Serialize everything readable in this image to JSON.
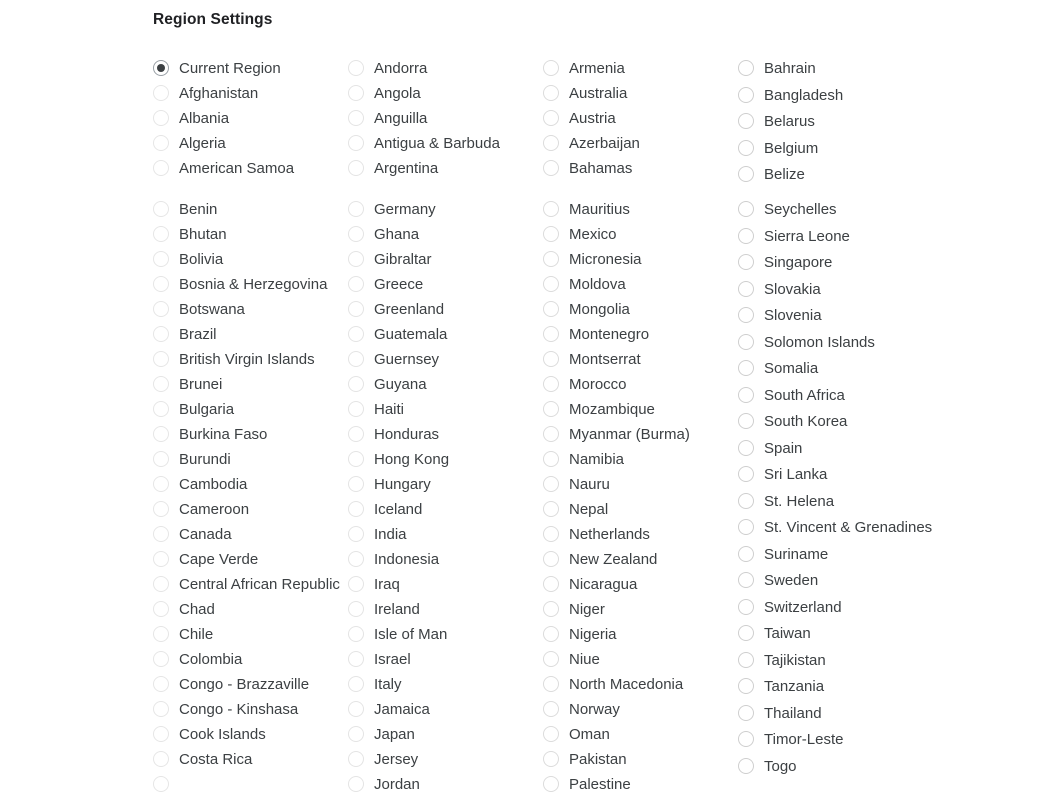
{
  "page": {
    "title": "Region Settings",
    "background_color": "#ffffff",
    "text_color": "#3c4043",
    "selected_dot_color": "#3c4043",
    "radio_ring_color": "#e2e2e2"
  },
  "selected_region": "Current Region",
  "groups": [
    {
      "name": "primary-region-group",
      "columns": [
        {
          "name": "column-a",
          "options": [
            {
              "label": "Current Region",
              "selected": true
            },
            {
              "label": "Afghanistan",
              "selected": false
            },
            {
              "label": "Albania",
              "selected": false
            },
            {
              "label": "Algeria",
              "selected": false
            },
            {
              "label": "American Samoa",
              "selected": false
            }
          ]
        },
        {
          "name": "column-b",
          "options": [
            {
              "label": "Andorra",
              "selected": false
            },
            {
              "label": "Angola",
              "selected": false
            },
            {
              "label": "Anguilla",
              "selected": false
            },
            {
              "label": "Antigua & Barbuda",
              "selected": false
            },
            {
              "label": "Argentina",
              "selected": false
            }
          ]
        },
        {
          "name": "column-c",
          "options": [
            {
              "label": "Armenia",
              "selected": false
            },
            {
              "label": "Australia",
              "selected": false
            },
            {
              "label": "Austria",
              "selected": false
            },
            {
              "label": "Azerbaijan",
              "selected": false
            },
            {
              "label": "Bahamas",
              "selected": false
            }
          ]
        },
        {
          "name": "column-d",
          "options": [
            {
              "label": "Bahrain",
              "selected": false
            },
            {
              "label": "Bangladesh",
              "selected": false
            },
            {
              "label": "Belarus",
              "selected": false
            },
            {
              "label": "Belgium",
              "selected": false
            },
            {
              "label": "Belize",
              "selected": false
            }
          ]
        }
      ]
    },
    {
      "name": "secondary-region-group",
      "columns": [
        {
          "name": "column-a",
          "options": [
            {
              "label": "Benin",
              "selected": false
            },
            {
              "label": "Bhutan",
              "selected": false
            },
            {
              "label": "Bolivia",
              "selected": false
            },
            {
              "label": "Bosnia & Herzegovina",
              "selected": false
            },
            {
              "label": "Botswana",
              "selected": false
            },
            {
              "label": "Brazil",
              "selected": false
            },
            {
              "label": "British Virgin Islands",
              "selected": false
            },
            {
              "label": "Brunei",
              "selected": false
            },
            {
              "label": "Bulgaria",
              "selected": false
            },
            {
              "label": "Burkina Faso",
              "selected": false
            },
            {
              "label": "Burundi",
              "selected": false
            },
            {
              "label": "Cambodia",
              "selected": false
            },
            {
              "label": "Cameroon",
              "selected": false
            },
            {
              "label": "Canada",
              "selected": false
            },
            {
              "label": "Cape Verde",
              "selected": false
            },
            {
              "label": "Central African Republic",
              "selected": false
            },
            {
              "label": "Chad",
              "selected": false
            },
            {
              "label": "Chile",
              "selected": false
            },
            {
              "label": "Colombia",
              "selected": false
            },
            {
              "label": "Congo - Brazzaville",
              "selected": false
            },
            {
              "label": "Congo - Kinshasa",
              "selected": false
            },
            {
              "label": "Cook Islands",
              "selected": false
            },
            {
              "label": "Costa Rica",
              "selected": false
            },
            {
              "label": "",
              "selected": false
            }
          ]
        },
        {
          "name": "column-b",
          "options": [
            {
              "label": "Germany",
              "selected": false
            },
            {
              "label": "Ghana",
              "selected": false
            },
            {
              "label": "Gibraltar",
              "selected": false
            },
            {
              "label": "Greece",
              "selected": false
            },
            {
              "label": "Greenland",
              "selected": false
            },
            {
              "label": "Guatemala",
              "selected": false
            },
            {
              "label": "Guernsey",
              "selected": false
            },
            {
              "label": "Guyana",
              "selected": false
            },
            {
              "label": "Haiti",
              "selected": false
            },
            {
              "label": "Honduras",
              "selected": false
            },
            {
              "label": "Hong Kong",
              "selected": false
            },
            {
              "label": "Hungary",
              "selected": false
            },
            {
              "label": "Iceland",
              "selected": false
            },
            {
              "label": "India",
              "selected": false
            },
            {
              "label": "Indonesia",
              "selected": false
            },
            {
              "label": "Iraq",
              "selected": false
            },
            {
              "label": "Ireland",
              "selected": false
            },
            {
              "label": "Isle of Man",
              "selected": false
            },
            {
              "label": "Israel",
              "selected": false
            },
            {
              "label": "Italy",
              "selected": false
            },
            {
              "label": "Jamaica",
              "selected": false
            },
            {
              "label": "Japan",
              "selected": false
            },
            {
              "label": "Jersey",
              "selected": false
            },
            {
              "label": "Jordan",
              "selected": false
            }
          ]
        },
        {
          "name": "column-c",
          "options": [
            {
              "label": "Mauritius",
              "selected": false
            },
            {
              "label": "Mexico",
              "selected": false
            },
            {
              "label": "Micronesia",
              "selected": false
            },
            {
              "label": "Moldova",
              "selected": false
            },
            {
              "label": "Mongolia",
              "selected": false
            },
            {
              "label": "Montenegro",
              "selected": false
            },
            {
              "label": "Montserrat",
              "selected": false
            },
            {
              "label": "Morocco",
              "selected": false
            },
            {
              "label": "Mozambique",
              "selected": false
            },
            {
              "label": "Myanmar (Burma)",
              "selected": false
            },
            {
              "label": "Namibia",
              "selected": false
            },
            {
              "label": "Nauru",
              "selected": false
            },
            {
              "label": "Nepal",
              "selected": false
            },
            {
              "label": "Netherlands",
              "selected": false
            },
            {
              "label": "New Zealand",
              "selected": false
            },
            {
              "label": "Nicaragua",
              "selected": false
            },
            {
              "label": "Niger",
              "selected": false
            },
            {
              "label": "Nigeria",
              "selected": false
            },
            {
              "label": "Niue",
              "selected": false
            },
            {
              "label": "North Macedonia",
              "selected": false
            },
            {
              "label": "Norway",
              "selected": false
            },
            {
              "label": "Oman",
              "selected": false
            },
            {
              "label": "Pakistan",
              "selected": false
            },
            {
              "label": "Palestine",
              "selected": false
            }
          ]
        },
        {
          "name": "column-d",
          "options": [
            {
              "label": "Seychelles",
              "selected": false
            },
            {
              "label": "Sierra Leone",
              "selected": false
            },
            {
              "label": "Singapore",
              "selected": false
            },
            {
              "label": "Slovakia",
              "selected": false
            },
            {
              "label": "Slovenia",
              "selected": false
            },
            {
              "label": "Solomon Islands",
              "selected": false
            },
            {
              "label": "Somalia",
              "selected": false
            },
            {
              "label": "South Africa",
              "selected": false
            },
            {
              "label": "South Korea",
              "selected": false
            },
            {
              "label": "Spain",
              "selected": false
            },
            {
              "label": "Sri Lanka",
              "selected": false
            },
            {
              "label": "St. Helena",
              "selected": false
            },
            {
              "label": "St. Vincent & Grenadines",
              "selected": false
            },
            {
              "label": "Suriname",
              "selected": false
            },
            {
              "label": "Sweden",
              "selected": false
            },
            {
              "label": "Switzerland",
              "selected": false
            },
            {
              "label": "Taiwan",
              "selected": false
            },
            {
              "label": "Tajikistan",
              "selected": false
            },
            {
              "label": "Tanzania",
              "selected": false
            },
            {
              "label": "Thailand",
              "selected": false
            },
            {
              "label": "Timor-Leste",
              "selected": false
            },
            {
              "label": "Togo",
              "selected": false
            }
          ]
        }
      ]
    }
  ]
}
